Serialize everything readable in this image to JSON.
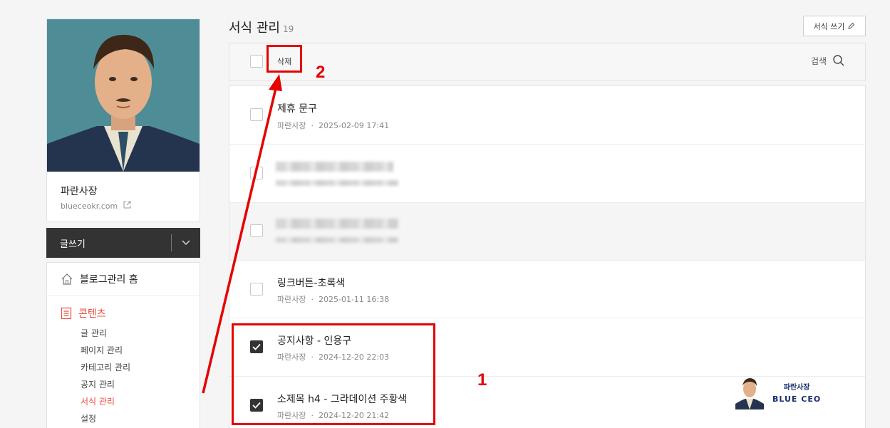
{
  "profile": {
    "name": "파란사장",
    "url": "blueceokr.com"
  },
  "write_bar": {
    "label": "글쓰기"
  },
  "menu": {
    "home_label": "블로그관리 홈",
    "section_label": "콘텐츠",
    "items": [
      "글 관리",
      "페이지 관리",
      "카테고리 관리",
      "공지 관리",
      "서식 관리",
      "설정"
    ],
    "active_item": "서식 관리"
  },
  "header": {
    "title": "서식 관리",
    "count": "19",
    "write_button": "서식 쓰기"
  },
  "toolbar": {
    "delete_label": "삭제",
    "search_label": "검색"
  },
  "rows": [
    {
      "title": "제휴 문구",
      "author": "파란사장",
      "date": "2025-02-09 17:41",
      "checked": false,
      "blurred": false
    },
    {
      "title": "",
      "author": "",
      "date": "",
      "checked": false,
      "blurred": true
    },
    {
      "title": "",
      "author": "",
      "date": "",
      "checked": false,
      "blurred": true
    },
    {
      "title": "링크버튼-초록색",
      "author": "파란사장",
      "date": "2025-01-11 16:38",
      "checked": false,
      "blurred": false
    },
    {
      "title": "공지사항 - 인용구",
      "author": "파란사장",
      "date": "2024-12-20 22:03",
      "checked": true,
      "blurred": false
    },
    {
      "title": "소제목 h4 - 그라데이션 주황색",
      "author": "파란사장",
      "date": "2024-12-20 21:42",
      "checked": true,
      "blurred": false
    }
  ],
  "annotations": {
    "step1": "1",
    "step2": "2"
  },
  "brand": {
    "korean": "파란사장",
    "english": "BLUE CEO"
  },
  "colors": {
    "accent": "#e84e3e",
    "annotation": "#e60000",
    "dark_bar": "#333333"
  }
}
